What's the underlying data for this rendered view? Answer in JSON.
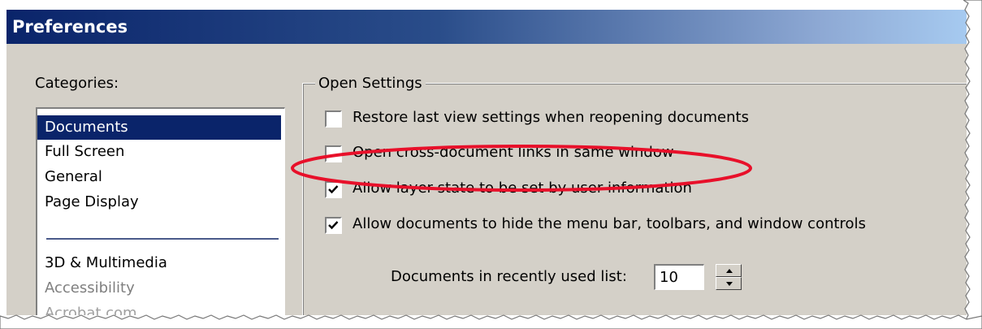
{
  "window": {
    "title": "Preferences"
  },
  "categories_label": "Categories:",
  "categories": [
    {
      "label": "Documents",
      "state": "selected"
    },
    {
      "label": "Full Screen",
      "state": "normal"
    },
    {
      "label": "General",
      "state": "normal"
    },
    {
      "label": "Page Display",
      "state": "normal"
    },
    {
      "label": "3D & Multimedia",
      "state": "normal"
    },
    {
      "label": "Accessibility",
      "state": "dim"
    },
    {
      "label": "Acrobat.com",
      "state": "faint"
    }
  ],
  "open_settings": {
    "group_label": "Open Settings",
    "options": [
      {
        "label": "Restore last view settings when reopening documents",
        "checked": false
      },
      {
        "label": "Open cross-document links in same window",
        "checked": false,
        "highlighted": true
      },
      {
        "label": "Allow layer state to be set by user information",
        "checked": true
      },
      {
        "label": "Allow documents to hide the menu bar, toolbars, and window controls",
        "checked": true
      }
    ],
    "recent_list": {
      "label": "Documents in recently used list:",
      "value": "10"
    }
  },
  "colors": {
    "selection": "#0a246a",
    "dialog_face": "#d4d0c8",
    "annotation": "#e8102a"
  },
  "icons": {
    "checkmark": "checkmark-icon",
    "spin_up": "arrow-up-icon",
    "spin_down": "arrow-down-icon"
  }
}
